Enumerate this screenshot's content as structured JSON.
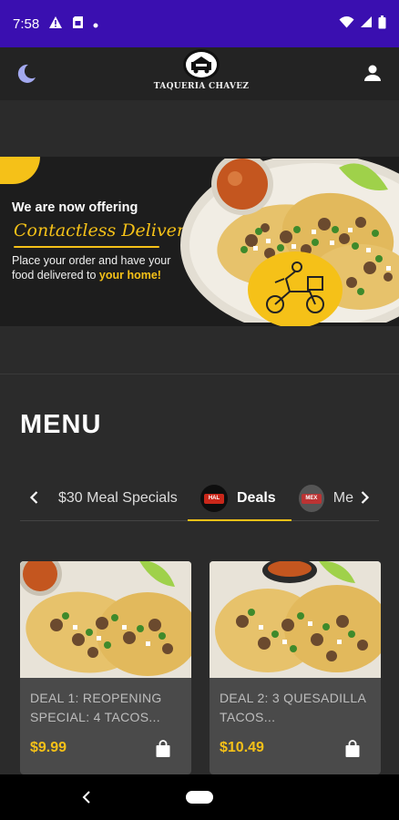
{
  "status": {
    "time": "7:58"
  },
  "header": {
    "logo_text": "TAQUERIA CHAVEZ"
  },
  "hero": {
    "line1": "We are now offering",
    "script": "Contactless Delivery",
    "desc_prefix": "Place your order and have your food delivered to ",
    "desc_highlight": "your home!"
  },
  "menu": {
    "title": "MENU",
    "tabs": [
      {
        "label": "$30 Meal Specials"
      },
      {
        "label": "Deals",
        "selected": true
      },
      {
        "label": "Me"
      }
    ]
  },
  "cards": [
    {
      "title": "DEAL 1: REOPENING SPECIAL: 4 TACOS...",
      "price": "$9.99"
    },
    {
      "title": "DEAL 2: 3 QUESADILLA TACOS...",
      "price": "$10.49"
    }
  ],
  "colors": {
    "status_bar": "#3a0fb0",
    "accent": "#f5c118",
    "background": "#2b2b2b"
  }
}
